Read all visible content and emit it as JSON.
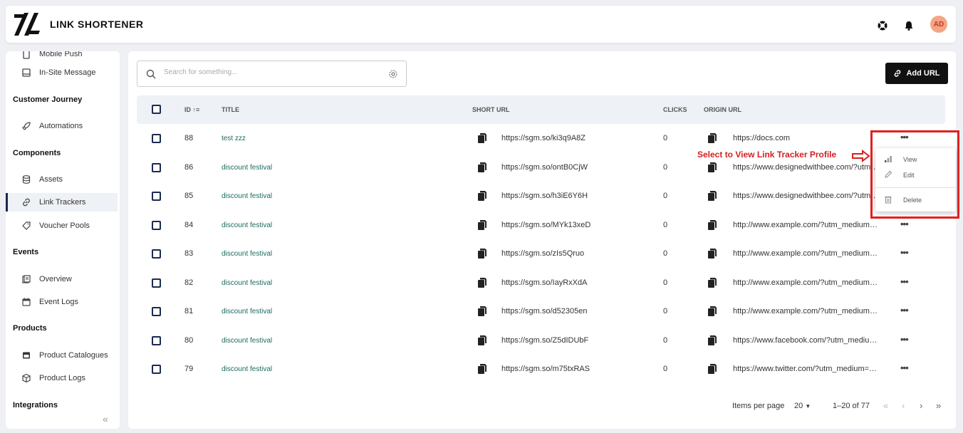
{
  "header": {
    "app_title": "LINK SHORTENER",
    "avatar_initials": "AD",
    "icons": [
      "support-icon",
      "bell-icon"
    ]
  },
  "sidebar": {
    "partial_top": "Mobile Push",
    "in_site": "In-Site Message",
    "sections": {
      "customer_journey": "Customer Journey",
      "components": "Components",
      "events": "Events",
      "products": "Products",
      "integrations": "Integrations"
    },
    "items": {
      "automations": "Automations",
      "assets": "Assets",
      "link_trackers": "Link Trackers",
      "voucher_pools": "Voucher Pools",
      "overview": "Overview",
      "event_logs": "Event Logs",
      "product_catalogues": "Product Catalogues",
      "product_logs": "Product Logs"
    }
  },
  "toolbar": {
    "search_placeholder": "Search for something...",
    "add_url_label": "Add URL"
  },
  "table": {
    "columns": {
      "id": "ID",
      "title": "TITLE",
      "short_url": "SHORT URL",
      "clicks": "CLICKS",
      "origin_url": "ORIGIN URL"
    },
    "rows": [
      {
        "id": "88",
        "title": "test zzz",
        "short_url": "https://sgm.so/ki3q9A8Z",
        "clicks": "0",
        "origin": "https://docs.com"
      },
      {
        "id": "86",
        "title": "discount festival",
        "short_url": "https://sgm.so/ontB0CjW",
        "clicks": "0",
        "origin": "https://www.designedwithbee.com/?utm_medium"
      },
      {
        "id": "85",
        "title": "discount festival",
        "short_url": "https://sgm.so/h3iE6Y6H",
        "clicks": "0",
        "origin": "https://www.designedwithbee.com/?utm_medium"
      },
      {
        "id": "84",
        "title": "discount festival",
        "short_url": "https://sgm.so/MYk13xeD",
        "clicks": "0",
        "origin": "http://www.example.com/?utm_medium=email"
      },
      {
        "id": "83",
        "title": "discount festival",
        "short_url": "https://sgm.so/zIs5Qruo",
        "clicks": "0",
        "origin": "http://www.example.com/?utm_medium=email"
      },
      {
        "id": "82",
        "title": "discount festival",
        "short_url": "https://sgm.so/IayRxXdA",
        "clicks": "0",
        "origin": "http://www.example.com/?utm_medium=email"
      },
      {
        "id": "81",
        "title": "discount festival",
        "short_url": "https://sgm.so/d52305en",
        "clicks": "0",
        "origin": "http://www.example.com/?utm_medium=email"
      },
      {
        "id": "80",
        "title": "discount festival",
        "short_url": "https://sgm.so/Z5dIDUbF",
        "clicks": "0",
        "origin": "https://www.facebook.com/?utm_medium=email"
      },
      {
        "id": "79",
        "title": "discount festival",
        "short_url": "https://sgm.so/m75txRAS",
        "clicks": "0",
        "origin": "https://www.twitter.com/?utm_medium=email"
      }
    ]
  },
  "pagination": {
    "items_per_page_label": "Items per page",
    "page_size": "20",
    "range": "1–20 of 77"
  },
  "context_menu": {
    "view": "View",
    "edit": "Edit",
    "delete": "Delete"
  },
  "annotation": {
    "text": "Select to View Link Tracker Profile",
    "color": "#d42020"
  },
  "colors": {
    "brand_dark": "#1b2a52",
    "title_link": "#1e6b5c",
    "avatar_bg": "#f4a582"
  }
}
